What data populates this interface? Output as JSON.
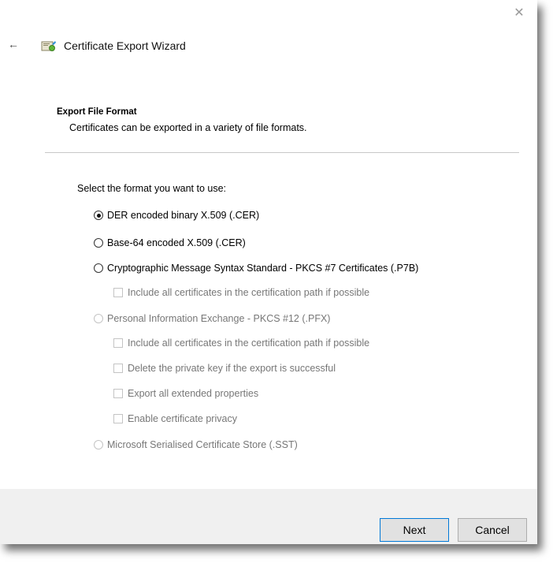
{
  "window": {
    "title": "Certificate Export Wizard",
    "icons": {
      "close": "close-icon",
      "back": "back-arrow-icon",
      "app": "certificate-icon"
    }
  },
  "section": {
    "heading": "Export File Format",
    "subheading": "Certificates can be exported in a variety of file formats."
  },
  "prompt": "Select the format you want to use:",
  "formats": [
    {
      "label": "DER encoded binary X.509 (.CER)",
      "selected": true,
      "enabled": true
    },
    {
      "label": "Base-64 encoded X.509 (.CER)",
      "selected": false,
      "enabled": true
    },
    {
      "label": "Cryptographic Message Syntax Standard - PKCS #7 Certificates (.P7B)",
      "selected": false,
      "enabled": true
    },
    {
      "label": "Personal Information Exchange - PKCS #12 (.PFX)",
      "selected": false,
      "enabled": false
    },
    {
      "label": "Microsoft Serialised Certificate Store (.SST)",
      "selected": false,
      "enabled": false
    }
  ],
  "p7b_options": [
    {
      "label": "Include all certificates in the certification path if possible",
      "checked": false,
      "enabled": false
    }
  ],
  "pfx_options": [
    {
      "label": "Include all certificates in the certification path if possible",
      "checked": false,
      "enabled": false
    },
    {
      "label": "Delete the private key if the export is successful",
      "checked": false,
      "enabled": false
    },
    {
      "label": "Export all extended properties",
      "checked": false,
      "enabled": false
    },
    {
      "label": "Enable certificate privacy",
      "checked": false,
      "enabled": false
    }
  ],
  "buttons": {
    "next": "Next",
    "cancel": "Cancel"
  },
  "colors": {
    "accent": "#0078d7",
    "footer": "#f0f0f0",
    "disabled_text": "#777777"
  }
}
